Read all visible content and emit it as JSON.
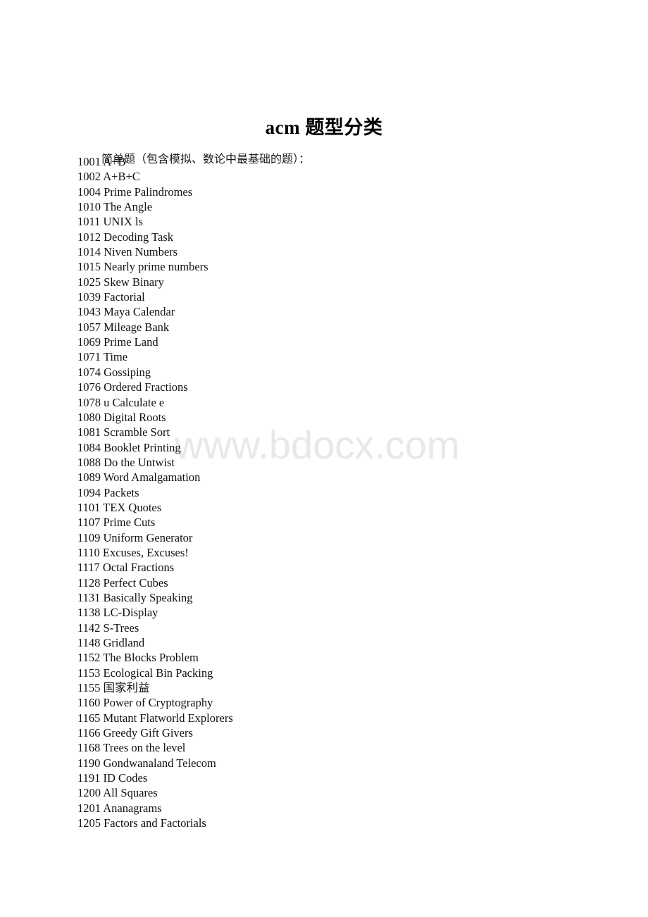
{
  "document": {
    "title": "acm 题型分类",
    "section_heading": "简单题（包含模拟、数论中最基础的题）：",
    "watermark": "www.bdocx.com"
  },
  "problems": [
    {
      "id": "1001",
      "title": "A+B"
    },
    {
      "id": "1002",
      "title": "A+B+C"
    },
    {
      "id": "1004",
      "title": "Prime Palindromes"
    },
    {
      "id": "1010",
      "title": "The Angle"
    },
    {
      "id": "1011",
      "title": "UNIX ls"
    },
    {
      "id": "1012",
      "title": "Decoding Task"
    },
    {
      "id": "1014",
      "title": "Niven Numbers"
    },
    {
      "id": "1015",
      "title": "Nearly prime numbers"
    },
    {
      "id": "1025",
      "title": "Skew Binary"
    },
    {
      "id": "1039",
      "title": "Factorial"
    },
    {
      "id": "1043",
      "title": "Maya Calendar"
    },
    {
      "id": "1057",
      "title": "Mileage Bank"
    },
    {
      "id": "1069",
      "title": "Prime Land"
    },
    {
      "id": "1071",
      "title": "Time"
    },
    {
      "id": "1074",
      "title": "Gossiping"
    },
    {
      "id": "1076",
      "title": "Ordered Fractions"
    },
    {
      "id": "1078",
      "title": "u Calculate e"
    },
    {
      "id": "1080",
      "title": "Digital Roots"
    },
    {
      "id": "1081",
      "title": "Scramble Sort"
    },
    {
      "id": "1084",
      "title": "Booklet Printing"
    },
    {
      "id": "1088",
      "title": "Do the Untwist"
    },
    {
      "id": "1089",
      "title": "Word Amalgamation"
    },
    {
      "id": "1094",
      "title": "Packets"
    },
    {
      "id": "1101",
      "title": "TEX Quotes"
    },
    {
      "id": "1107",
      "title": "Prime Cuts"
    },
    {
      "id": "1109",
      "title": "Uniform Generator"
    },
    {
      "id": "1110",
      "title": "Excuses, Excuses!"
    },
    {
      "id": "1117",
      "title": "Octal Fractions"
    },
    {
      "id": "1128",
      "title": "Perfect Cubes"
    },
    {
      "id": "1131",
      "title": "Basically Speaking"
    },
    {
      "id": "1138",
      "title": "LC-Display"
    },
    {
      "id": "1142",
      "title": "S-Trees"
    },
    {
      "id": "1148",
      "title": "Gridland"
    },
    {
      "id": "1152",
      "title": "The Blocks Problem"
    },
    {
      "id": "1153",
      "title": "Ecological Bin Packing"
    },
    {
      "id": "1155",
      "title": "国家利益"
    },
    {
      "id": "1160",
      "title": "Power of Cryptography"
    },
    {
      "id": "1165",
      "title": "Mutant Flatworld Explorers"
    },
    {
      "id": "1166",
      "title": "Greedy Gift Givers"
    },
    {
      "id": "1168",
      "title": "Trees on the level"
    },
    {
      "id": "1190",
      "title": "Gondwanaland Telecom"
    },
    {
      "id": "1191",
      "title": "ID Codes"
    },
    {
      "id": "1200",
      "title": "All Squares"
    },
    {
      "id": "1201",
      "title": "Ananagrams"
    },
    {
      "id": "1205",
      "title": "Factors and Factorials"
    }
  ],
  "colors": {
    "page_background": "#ffffff",
    "text": "#111111",
    "watermark": "#e8e8e8"
  }
}
